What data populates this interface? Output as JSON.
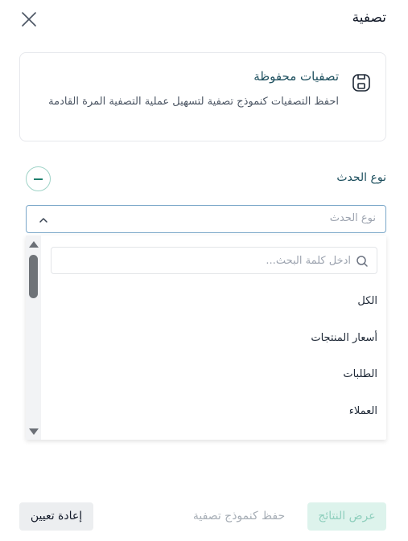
{
  "header": {
    "title": "تصفية",
    "close_icon": "close-icon"
  },
  "saved_filters": {
    "title": "تصفيات محفوظة",
    "description": "احفظ التصفيات كنموذج تصفية لتسهيل عملية التصفية المرة القادمة",
    "icon": "save-icon"
  },
  "event_type": {
    "label": "نوع الحدث",
    "select_placeholder": "نوع الحدث",
    "search_placeholder": "ادخل كلمة البحث...",
    "options": [
      "الكل",
      "أسعار المنتجات",
      "الطلبات",
      "العملاء"
    ]
  },
  "footer": {
    "show_results": "عرض النتائج",
    "save_as_template": "حفظ كنموذج تصفية",
    "reset": "إعادة تعيين"
  },
  "colors": {
    "accent": "#1e7f6e",
    "heading": "#1d4f5e",
    "primary_disabled_bg": "#ddf3ec"
  }
}
